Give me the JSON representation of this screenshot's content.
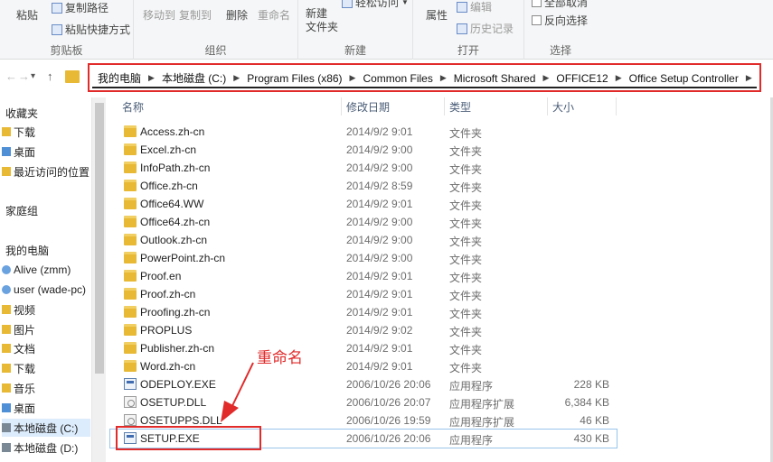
{
  "ribbon": {
    "clipboard": {
      "paste": "粘贴",
      "copy_path": "复制路径",
      "paste_shortcut": "粘贴快捷方式",
      "label": "剪贴板"
    },
    "organize": {
      "move_to": "移动到",
      "copy_to": "复制到",
      "delete": "删除",
      "rename": "重命名",
      "label": "组织"
    },
    "new": {
      "new_folder": "新建\n文件夹",
      "easy_access": "轻松访问",
      "label": "新建"
    },
    "open": {
      "properties": "属性",
      "edit": "编辑",
      "history": "历史记录",
      "label": "打开"
    },
    "select": {
      "select_none": "全部取消",
      "invert": "反向选择",
      "label": "选择"
    }
  },
  "nav": {
    "back": "←",
    "forward": "→",
    "recent": "▾",
    "up": "↑"
  },
  "address": {
    "crumbs": [
      "我的电脑",
      "本地磁盘 (C:)",
      "Program Files (x86)",
      "Common Files",
      "Microsoft Shared",
      "OFFICE12",
      "Office Setup Controller"
    ]
  },
  "sidebar": {
    "items": [
      {
        "label": "收藏夹"
      },
      {
        "label": "下载"
      },
      {
        "label": "桌面"
      },
      {
        "label": "最近访问的位置"
      },
      {
        "label": "家庭组"
      },
      {
        "label": "我的电脑"
      },
      {
        "label": "Alive (zmm)"
      },
      {
        "label": "user (wade-pc)"
      },
      {
        "label": "视频"
      },
      {
        "label": "图片"
      },
      {
        "label": "文档"
      },
      {
        "label": "下载"
      },
      {
        "label": "音乐"
      },
      {
        "label": "桌面"
      },
      {
        "label": "本地磁盘 (C:)"
      },
      {
        "label": "本地磁盘 (D:)"
      }
    ]
  },
  "columns": {
    "name": "名称",
    "date": "修改日期",
    "type": "类型",
    "size": "大小"
  },
  "files": [
    {
      "name": "Access.zh-cn",
      "date": "2014/9/2 9:01",
      "type": "文件夹",
      "size": "",
      "kind": "folder"
    },
    {
      "name": "Excel.zh-cn",
      "date": "2014/9/2 9:00",
      "type": "文件夹",
      "size": "",
      "kind": "folder"
    },
    {
      "name": "InfoPath.zh-cn",
      "date": "2014/9/2 9:00",
      "type": "文件夹",
      "size": "",
      "kind": "folder"
    },
    {
      "name": "Office.zh-cn",
      "date": "2014/9/2 8:59",
      "type": "文件夹",
      "size": "",
      "kind": "folder"
    },
    {
      "name": "Office64.WW",
      "date": "2014/9/2 9:01",
      "type": "文件夹",
      "size": "",
      "kind": "folder"
    },
    {
      "name": "Office64.zh-cn",
      "date": "2014/9/2 9:00",
      "type": "文件夹",
      "size": "",
      "kind": "folder"
    },
    {
      "name": "Outlook.zh-cn",
      "date": "2014/9/2 9:00",
      "type": "文件夹",
      "size": "",
      "kind": "folder"
    },
    {
      "name": "PowerPoint.zh-cn",
      "date": "2014/9/2 9:00",
      "type": "文件夹",
      "size": "",
      "kind": "folder"
    },
    {
      "name": "Proof.en",
      "date": "2014/9/2 9:01",
      "type": "文件夹",
      "size": "",
      "kind": "folder"
    },
    {
      "name": "Proof.zh-cn",
      "date": "2014/9/2 9:01",
      "type": "文件夹",
      "size": "",
      "kind": "folder"
    },
    {
      "name": "Proofing.zh-cn",
      "date": "2014/9/2 9:01",
      "type": "文件夹",
      "size": "",
      "kind": "folder"
    },
    {
      "name": "PROPLUS",
      "date": "2014/9/2 9:02",
      "type": "文件夹",
      "size": "",
      "kind": "folder"
    },
    {
      "name": "Publisher.zh-cn",
      "date": "2014/9/2 9:01",
      "type": "文件夹",
      "size": "",
      "kind": "folder"
    },
    {
      "name": "Word.zh-cn",
      "date": "2014/9/2 9:01",
      "type": "文件夹",
      "size": "",
      "kind": "folder"
    },
    {
      "name": "ODEPLOY.EXE",
      "date": "2006/10/26 20:06",
      "type": "应用程序",
      "size": "228 KB",
      "kind": "exe"
    },
    {
      "name": "OSETUP.DLL",
      "date": "2006/10/26 20:07",
      "type": "应用程序扩展",
      "size": "6,384 KB",
      "kind": "dll"
    },
    {
      "name": "OSETUPPS.DLL",
      "date": "2006/10/26 19:59",
      "type": "应用程序扩展",
      "size": "46 KB",
      "kind": "dll"
    },
    {
      "name": "SETUP.EXE",
      "date": "2006/10/26 20:06",
      "type": "应用程序",
      "size": "430 KB",
      "kind": "exe"
    }
  ],
  "annotation": {
    "text": "重命名",
    "color": "#e12a2a"
  }
}
